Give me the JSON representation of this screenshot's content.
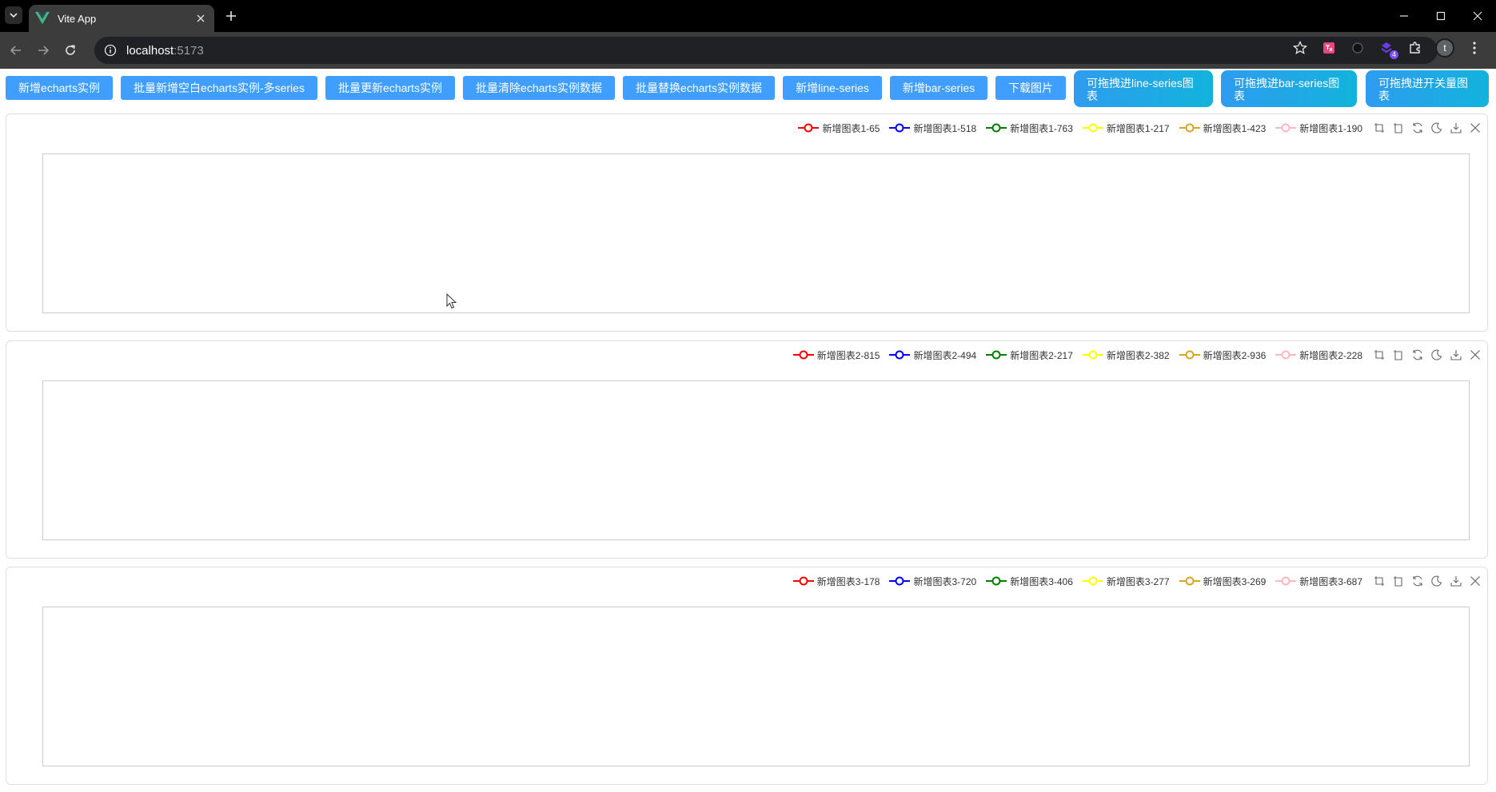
{
  "browser": {
    "tab_title": "Vite App",
    "url_host": "localhost",
    "url_port": ":5173",
    "profile_initial": "t",
    "extension_badge": "4"
  },
  "buttons": [
    {
      "label": "新增echarts实例"
    },
    {
      "label": "批量新增空白echarts实例-多series"
    },
    {
      "label": "批量更新echarts实例"
    },
    {
      "label": "批量清除echarts实例数据"
    },
    {
      "label": "批量替换echarts实例数据"
    },
    {
      "label": "新增line-series"
    },
    {
      "label": "新增bar-series"
    },
    {
      "label": "下载图片"
    }
  ],
  "drag_buttons": [
    {
      "label": "可拖拽进line-series图表"
    },
    {
      "label": "可拖拽进bar-series图表"
    },
    {
      "label": "可拖拽进开关量图表"
    }
  ],
  "colors": {
    "primary": "#409eff",
    "series": [
      "#ff0000",
      "#0000ff",
      "#008000",
      "#ffff00",
      "#daa520",
      "#ffb6c1"
    ]
  },
  "charts": [
    {
      "legend": [
        "新增图表1-65",
        "新增图表1-518",
        "新增图表1-763",
        "新增图表1-217",
        "新增图表1-423",
        "新增图表1-190"
      ]
    },
    {
      "legend": [
        "新增图表2-815",
        "新增图表2-494",
        "新增图表2-217",
        "新增图表2-382",
        "新增图表2-936",
        "新增图表2-228"
      ]
    },
    {
      "legend": [
        "新增图表3-178",
        "新增图表3-720",
        "新增图表3-406",
        "新增图表3-277",
        "新增图表3-269",
        "新增图表3-687"
      ]
    }
  ],
  "toolbox_icons": [
    "zoom-icon",
    "zoom-reset-icon",
    "restore-icon",
    "theme-toggle-icon",
    "download-icon",
    "close-icon"
  ]
}
